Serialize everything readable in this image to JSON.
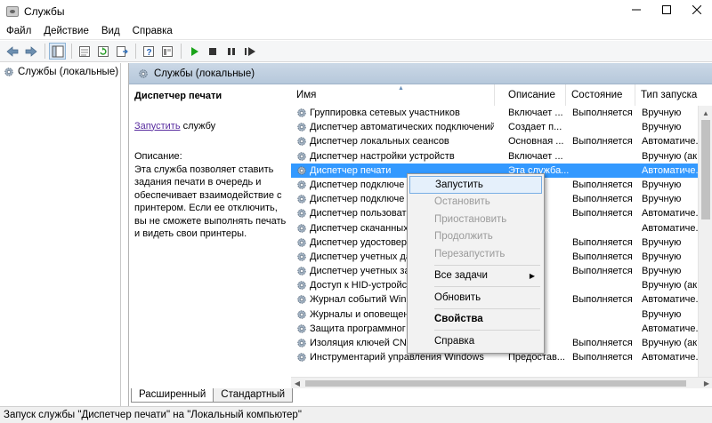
{
  "window": {
    "title": "Службы",
    "minimize_glyph": "—",
    "maximize_glyph": "☐",
    "close_glyph": "✕"
  },
  "menu": [
    "Файл",
    "Действие",
    "Вид",
    "Справка"
  ],
  "toolbar_icons": [
    "back-arrow-icon",
    "forward-arrow-icon",
    "show-pane-icon",
    "properties-list-icon",
    "refresh-icon",
    "export-icon",
    "help-icon",
    "console-icon",
    "play-icon",
    "stop-icon",
    "pause-icon",
    "restart-icon"
  ],
  "tree": {
    "item": "Службы (локальные)"
  },
  "pane_header": "Службы (локальные)",
  "details": {
    "service_name": "Диспетчер печати",
    "start_link": "Запустить",
    "start_suffix": " службу",
    "description_label": "Описание:",
    "description_text": "Эта служба позволяет ставить задания печати в очередь и обеспечивает взаимодействие с принтером. Если ее отключить, вы не сможете выполнять печать и видеть свои принтеры."
  },
  "columns": {
    "name": "Имя",
    "desc": "Описание",
    "state": "Состояние",
    "type": "Тип запуска"
  },
  "rows": [
    {
      "name": "Группировка сетевых участников",
      "desc": "Включает ...",
      "state": "Выполняется",
      "type": "Вручную"
    },
    {
      "name": "Диспетчер автоматических подключений...",
      "desc": "Создает п...",
      "state": "",
      "type": "Вручную"
    },
    {
      "name": "Диспетчер локальных сеансов",
      "desc": "Основная ...",
      "state": "Выполняется",
      "type": "Автоматиче..."
    },
    {
      "name": "Диспетчер настройки устройств",
      "desc": "Включает ...",
      "state": "",
      "type": "Вручную (ак..."
    },
    {
      "name": "Диспетчер печати",
      "desc": "Эта служба...",
      "state": "",
      "type": "Автоматиче..."
    },
    {
      "name": "Диспетчер подключе",
      "desc": "",
      "state": "Выполняется",
      "type": "Вручную"
    },
    {
      "name": "Диспетчер подключе",
      "desc": "",
      "state": "Выполняется",
      "type": "Вручную"
    },
    {
      "name": "Диспетчер пользоват",
      "desc": "",
      "state": "Выполняется",
      "type": "Автоматиче..."
    },
    {
      "name": "Диспетчер скачанных",
      "desc": "",
      "state": "",
      "type": "Автоматиче..."
    },
    {
      "name": "Диспетчер удостовер",
      "desc": "",
      "state": "Выполняется",
      "type": "Вручную"
    },
    {
      "name": "Диспетчер учетных да",
      "desc": "",
      "state": "Выполняется",
      "type": "Вручную"
    },
    {
      "name": "Диспетчер учетных за",
      "desc": "",
      "state": "Выполняется",
      "type": "Вручную"
    },
    {
      "name": "Доступ к HID-устройс",
      "desc": "",
      "state": "",
      "type": "Вручную (ак..."
    },
    {
      "name": "Журнал событий Wind",
      "desc": "",
      "state": "Выполняется",
      "type": "Автоматиче..."
    },
    {
      "name": "Журналы и оповещен",
      "desc": "",
      "state": "",
      "type": "Вручную"
    },
    {
      "name": "Защита программног",
      "desc": "",
      "state": "",
      "type": "Автоматиче..."
    },
    {
      "name": "Изоляция ключей CNG",
      "desc": "",
      "state": "Выполняется",
      "type": "Вручную (ак..."
    },
    {
      "name": "Инструментарий управления Windows",
      "desc": "Предостав...",
      "state": "Выполняется",
      "type": "Автоматиче..."
    }
  ],
  "selected_row_index": 4,
  "context_menu": {
    "start": "Запустить",
    "stop": "Остановить",
    "pause": "Приостановить",
    "resume": "Продолжить",
    "restart": "Перезапустить",
    "all_tasks": "Все задачи",
    "refresh": "Обновить",
    "properties": "Свойства",
    "help": "Справка"
  },
  "tabs": {
    "extended": "Расширенный",
    "standard": "Стандартный"
  },
  "status": "Запуск службы \"Диспетчер печати\" на \"Локальный компьютер\"",
  "colors": {
    "selection": "#3399ff",
    "header_strip": "#bccbdc",
    "link": "#5a2ea0",
    "play": "#1aa31a"
  }
}
